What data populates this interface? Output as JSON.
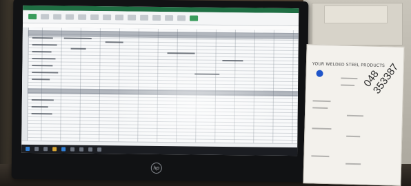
{
  "sign": {
    "title": "YOUR WELDED STEEL PRODUCTS",
    "code_top": "048",
    "code_bottom": "353387"
  },
  "monitor": {
    "logo": "hp"
  }
}
